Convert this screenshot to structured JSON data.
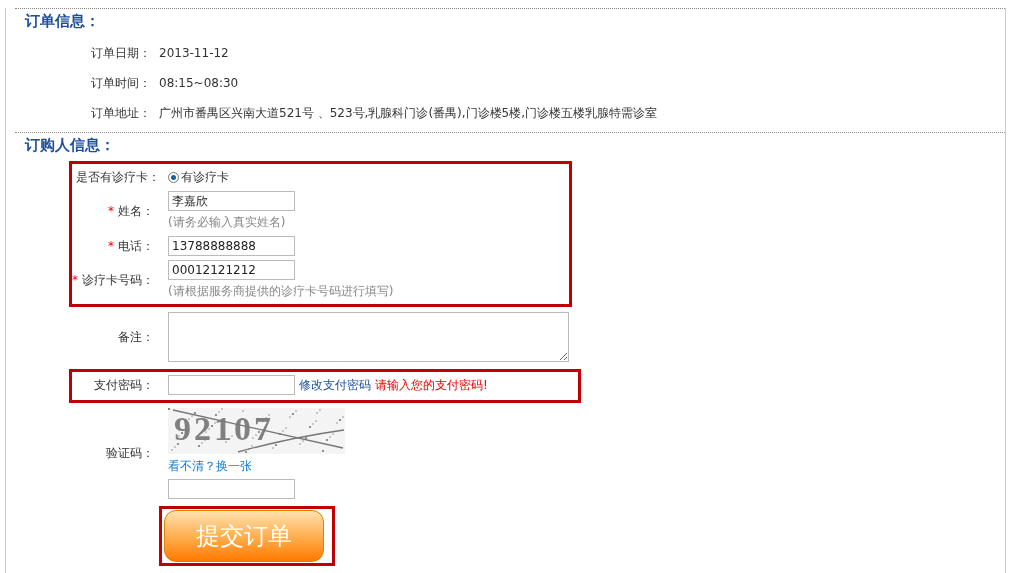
{
  "order_info": {
    "title": "订单信息：",
    "rows": [
      {
        "label": "订单日期：",
        "value": "2013-11-12"
      },
      {
        "label": "订单时间：",
        "value": "08:15~08:30"
      },
      {
        "label": "订单地址：",
        "value": "广州市番禺区兴南大道521号 、523号,乳腺科门诊(番禺),门诊楼5楼,门诊楼五楼乳腺特需诊室"
      }
    ]
  },
  "buyer_info": {
    "title": "订购人信息：",
    "groups": [
      {
        "highlighted": true,
        "rows": [
          {
            "kind": "radio",
            "label": "是否有诊疗卡：",
            "option": "有诊疗卡",
            "selected": true
          },
          {
            "kind": "input",
            "label": "姓名：",
            "required_mark": "*",
            "value": "李嘉欣",
            "hint": "(请务必输入真实姓名)"
          },
          {
            "kind": "input",
            "label": "电话：",
            "required_mark": "*",
            "value": "13788888888"
          },
          {
            "kind": "input",
            "label": "诊疗卡号码：",
            "required_mark": "*",
            "value": "00012121212",
            "hint": "(请根据服务商提供的诊疗卡号码进行填写)"
          }
        ]
      },
      {
        "highlighted": false,
        "rows": [
          {
            "kind": "textarea",
            "label": "备注："
          }
        ]
      },
      {
        "highlighted": true,
        "rows": [
          {
            "kind": "password",
            "label": "支付密码：",
            "link": "修改支付密码",
            "error": "请输入您的支付密码!"
          }
        ]
      },
      {
        "highlighted": false,
        "rows": [
          {
            "kind": "captcha",
            "label": "验证码：",
            "captcha": "92107",
            "refresh_link": "看不清？换一张"
          }
        ]
      },
      {
        "highlighted": true,
        "rows": [
          {
            "kind": "submit",
            "button": "提交订单"
          }
        ]
      }
    ]
  }
}
